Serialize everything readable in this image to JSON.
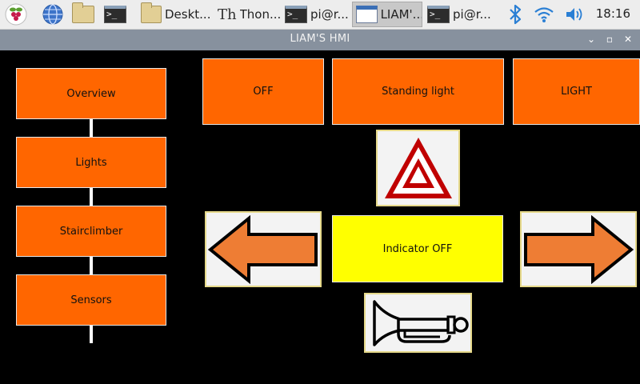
{
  "taskbar": {
    "items": [
      {
        "label": "Deskt..."
      },
      {
        "label": "Thon..."
      },
      {
        "label": "pi@r..."
      },
      {
        "label": "LIAM'..."
      },
      {
        "label": "pi@r..."
      }
    ],
    "clock": "18:16"
  },
  "window": {
    "title": "LIAM'S HMI",
    "controls": {
      "minimize": "⌄",
      "maximize": "▫",
      "close": "✕"
    }
  },
  "nav": {
    "items": [
      {
        "label": "Overview"
      },
      {
        "label": "Lights"
      },
      {
        "label": "Stairclimber"
      },
      {
        "label": "Sensors"
      }
    ]
  },
  "controls": {
    "off_label": "OFF",
    "standing_light_label": "Standing light",
    "light_label": "LIGHT",
    "indicator_label": "Indicator OFF"
  },
  "colors": {
    "button_orange": "#ff6600",
    "indicator_yellow": "#ffff00",
    "background": "#000000",
    "arrow_orange": "#ee7d34",
    "hazard_red": "#c00000"
  },
  "icons": {
    "hazard": "hazard-triangle-icon",
    "left": "left-arrow-icon",
    "right": "right-arrow-icon",
    "horn": "horn-icon"
  }
}
